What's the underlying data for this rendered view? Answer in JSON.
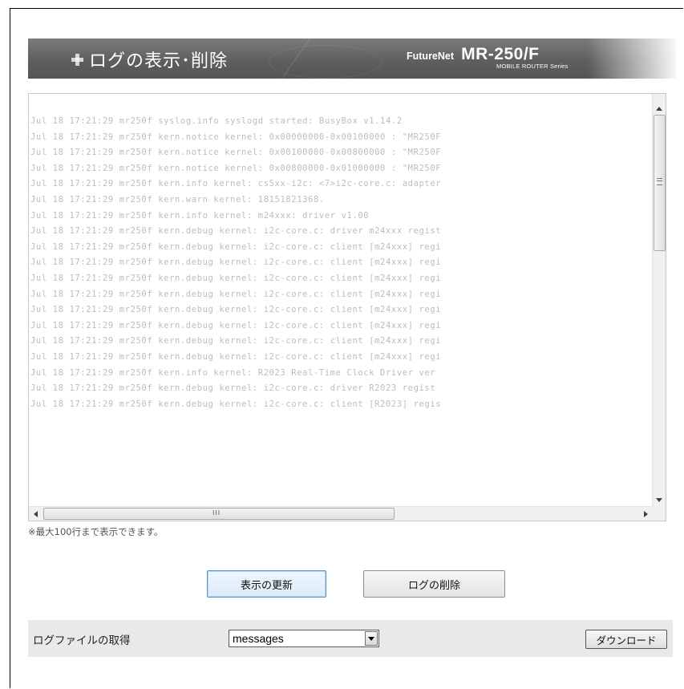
{
  "header": {
    "title": "ログの表示･削除",
    "brand_name": "FutureNet",
    "model": "MR-250/F",
    "series": "MOBILE ROUTER Series",
    "background_color": "#5f5f5f"
  },
  "log_viewer": {
    "lines": [
      "Jul 18 17:21:29 mr250f syslog.info syslogd started: BusyBox v1.14.2",
      "Jul 18 17:21:29 mr250f kern.notice kernel: 0x00000000-0x00100000 : \"MR250F",
      "Jul 18 17:21:29 mr250f kern.notice kernel: 0x00100000-0x00800000 : \"MR250F",
      "Jul 18 17:21:29 mr250f kern.notice kernel: 0x00800000-0x01000000 : \"MR250F",
      "Jul 18 17:21:29 mr250f kern.info kernel: cs5xx-i2c: <7>i2c-core.c: adapter",
      "Jul 18 17:21:29 mr250f kern.warn kernel: 18151821368.",
      "Jul 18 17:21:29 mr250f kern.info kernel: m24xxx: driver v1.00",
      "Jul 18 17:21:29 mr250f kern.debug kernel: i2c-core.c: driver m24xxx regist",
      "Jul 18 17:21:29 mr250f kern.debug kernel: i2c-core.c: client [m24xxx] regi",
      "Jul 18 17:21:29 mr250f kern.debug kernel: i2c-core.c: client [m24xxx] regi",
      "Jul 18 17:21:29 mr250f kern.debug kernel: i2c-core.c: client [m24xxx] regi",
      "Jul 18 17:21:29 mr250f kern.debug kernel: i2c-core.c: client [m24xxx] regi",
      "Jul 18 17:21:29 mr250f kern.debug kernel: i2c-core.c: client [m24xxx] regi",
      "Jul 18 17:21:29 mr250f kern.debug kernel: i2c-core.c: client [m24xxx] regi",
      "Jul 18 17:21:29 mr250f kern.debug kernel: i2c-core.c: client [m24xxx] regi",
      "Jul 18 17:21:29 mr250f kern.debug kernel: i2c-core.c: client [m24xxx] regi",
      "Jul 18 17:21:29 mr250f kern.info kernel: R2023 Real-Time Clock Driver ver",
      "Jul 18 17:21:29 mr250f kern.debug kernel: i2c-core.c: driver R2023 regist",
      "Jul 18 17:21:29 mr250f kern.debug kernel: i2c-core.c: client [R2023] regis"
    ],
    "note": "※最大100行まで表示できます。"
  },
  "buttons": {
    "refresh": "表示の更新",
    "delete": "ログの削除"
  },
  "download": {
    "label": "ログファイルの取得",
    "selected": "messages",
    "button": "ダウンロード"
  }
}
